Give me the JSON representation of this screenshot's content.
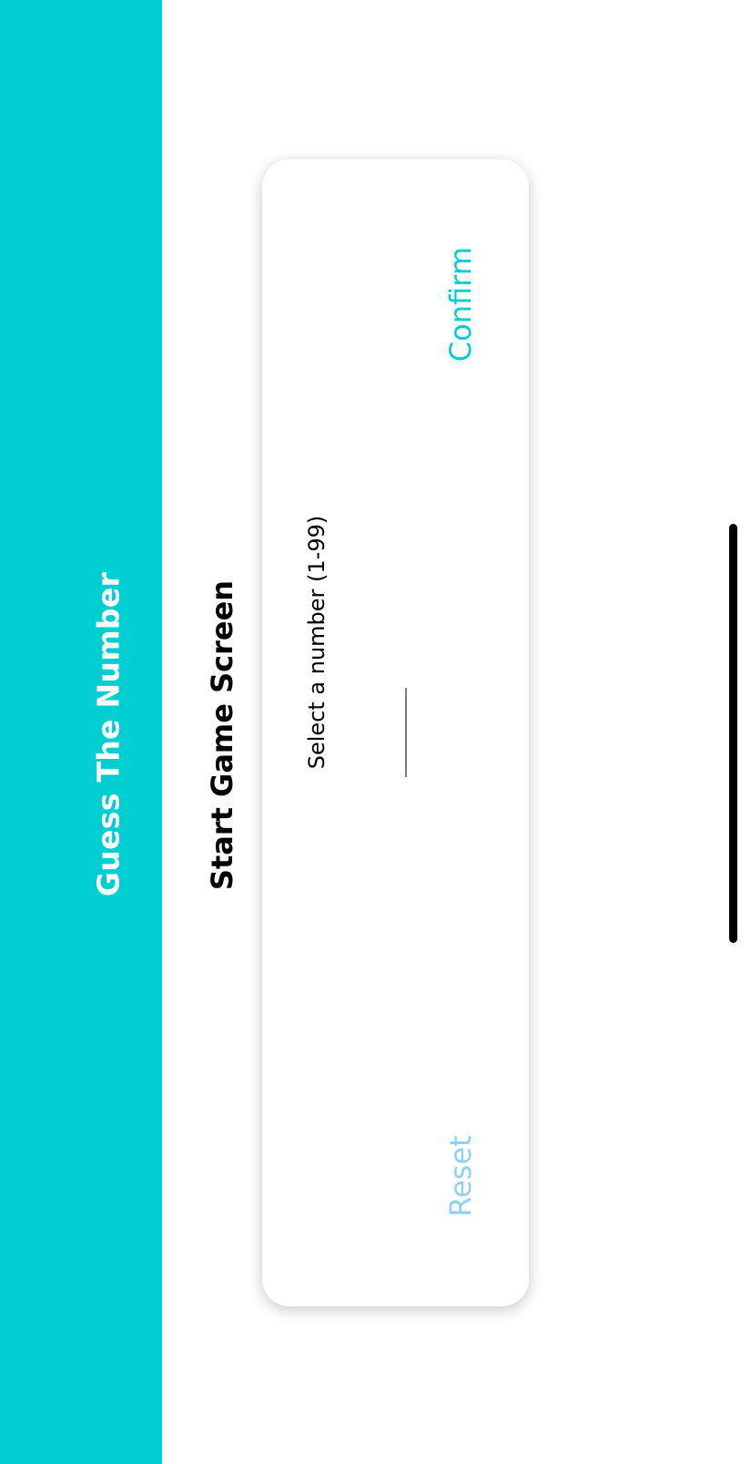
{
  "header": {
    "title": "Guess The Number"
  },
  "main": {
    "screen_title": "Start Game Screen"
  },
  "card": {
    "input_label": "Select a number (1-99)",
    "input_value": "",
    "confirm_label": "Confirm",
    "reset_label": "Reset"
  },
  "colors": {
    "primary": "#00ced1",
    "reset_button": "#8fd0f7",
    "background": "#ffffff",
    "title_text": "#000000"
  }
}
